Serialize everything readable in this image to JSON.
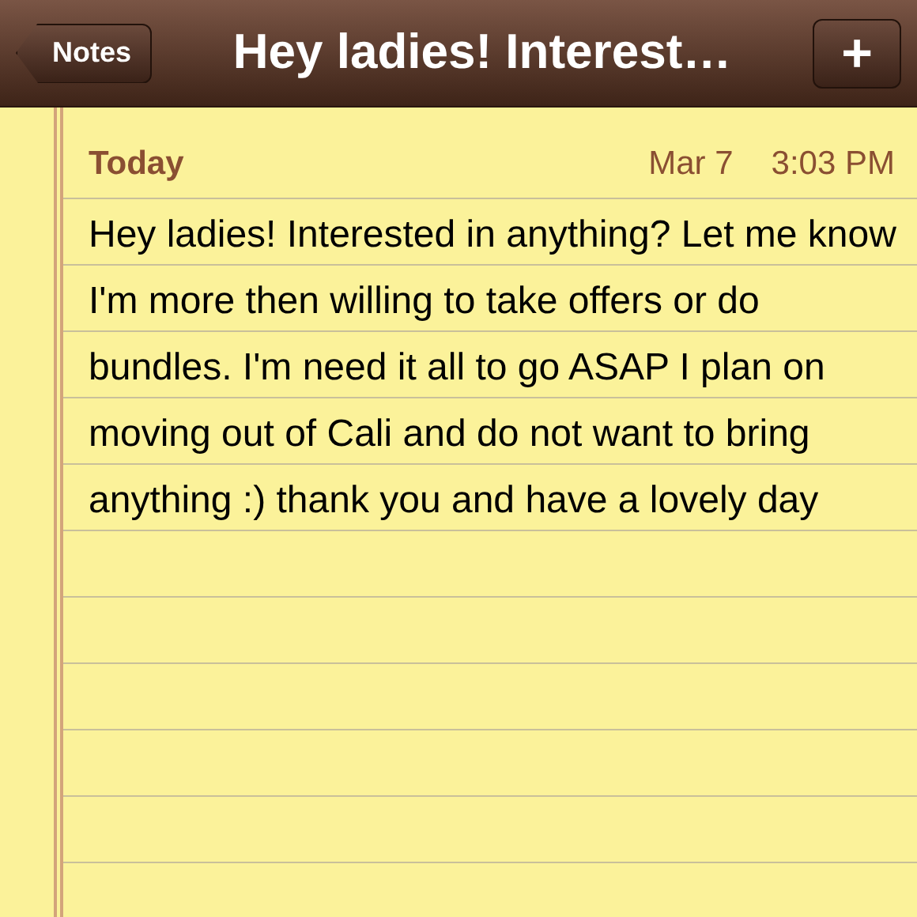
{
  "nav_bar": {
    "back_button": "Notes",
    "title": "Hey ladies! Interest…",
    "add_button": "+"
  },
  "note": {
    "day": "Today",
    "date": "Mar 7",
    "time": "3:03 PM",
    "body": "Hey ladies! Interested in anything? Let me know I'm more then willing to take offers or do bundles. I'm need it all to go ASAP I plan on moving out of Cali and do not want to bring anything :) thank you and have a lovely day"
  }
}
